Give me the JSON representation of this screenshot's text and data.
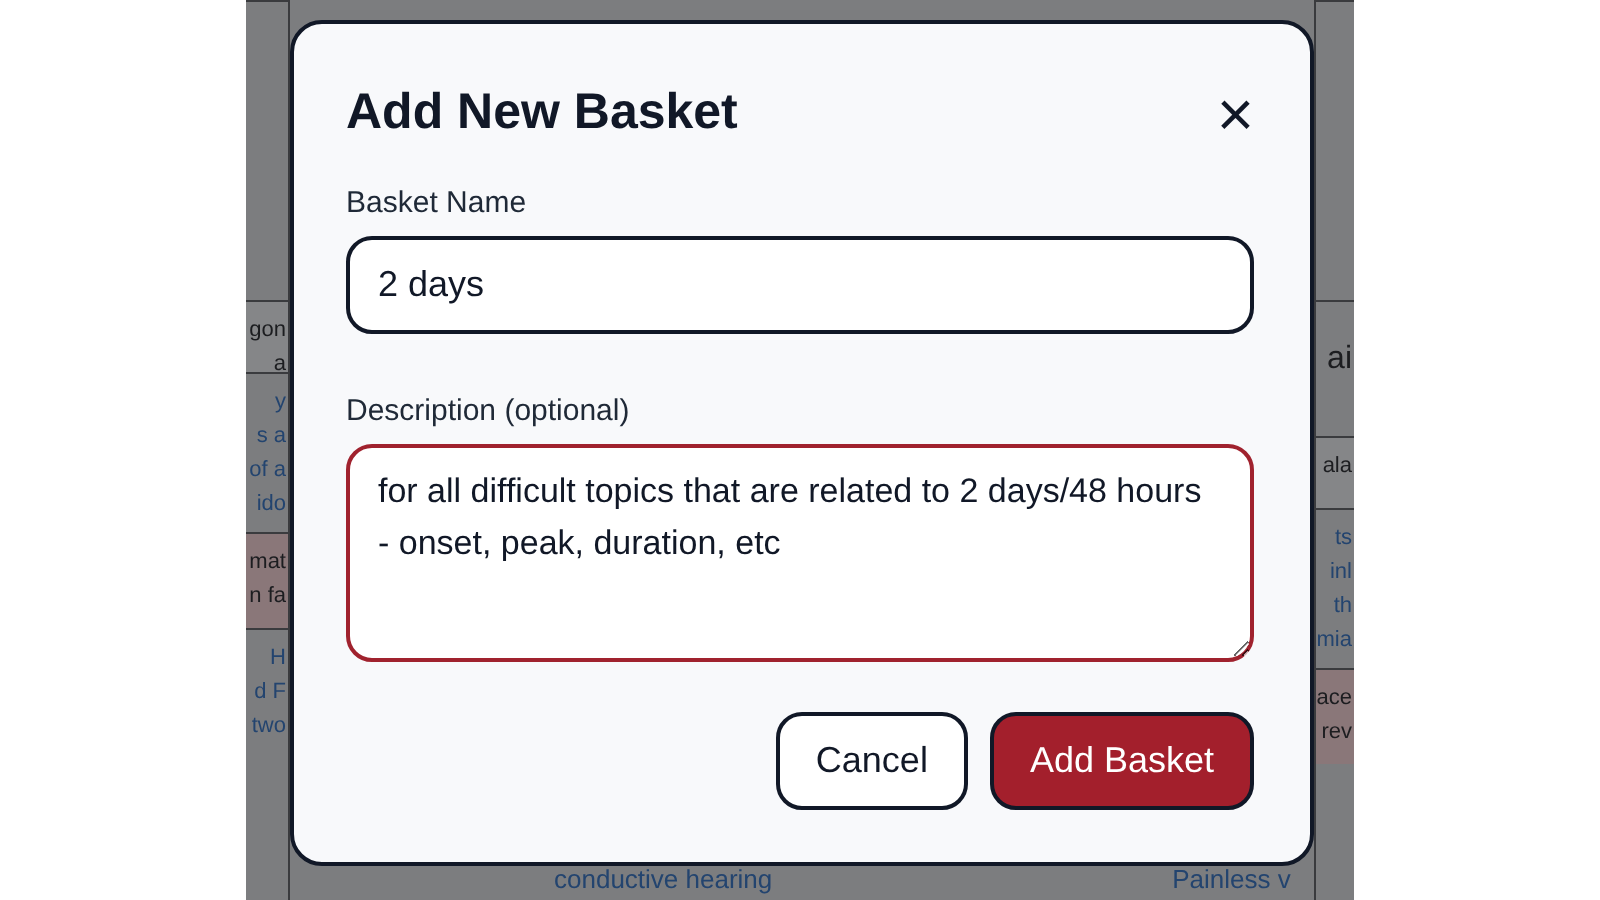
{
  "background": {
    "left_column": [
      {
        "kind": "blank"
      },
      {
        "kind": "header",
        "lines": [
          "gon",
          "a"
        ]
      },
      {
        "kind": "body",
        "lines": [
          "y",
          "s a",
          "of a",
          "ido"
        ]
      },
      {
        "kind": "alert",
        "lines": [
          "mat",
          "n fa"
        ]
      },
      {
        "kind": "body",
        "lines": [
          "H",
          "d F",
          "two"
        ]
      }
    ],
    "right_column": [
      {
        "kind": "blank"
      },
      {
        "kind": "title",
        "lines": [
          "ai"
        ]
      },
      {
        "kind": "header",
        "lines": [
          "ala"
        ]
      },
      {
        "kind": "body",
        "lines": [
          "ts",
          "inl",
          "th",
          "mia"
        ]
      },
      {
        "kind": "alert",
        "lines": [
          "ace",
          "rev"
        ]
      }
    ],
    "bottom_row": [
      "conductive hearing",
      "Painless v"
    ]
  },
  "dialog": {
    "title": "Add New Basket",
    "close": "×",
    "fields": [
      {
        "kind": "input",
        "label": "Basket Name",
        "value": "2 days",
        "focused": false
      },
      {
        "kind": "textarea",
        "label": "Description (optional)",
        "value": "for all difficult topics that are related to 2 days/48 hours - onset, peak, duration, etc",
        "focused": true
      }
    ],
    "buttons": [
      {
        "label": "Cancel",
        "kind": "secondary"
      },
      {
        "label": "Add Basket",
        "kind": "primary"
      }
    ]
  }
}
